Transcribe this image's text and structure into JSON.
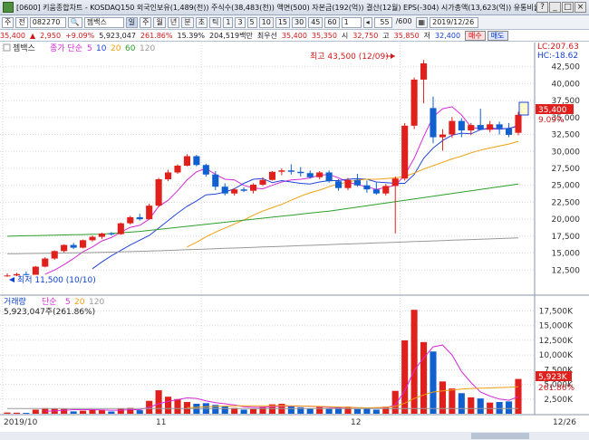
{
  "window": {
    "title": "[0600] 키움종합차트 - KOSDAQ150 외국인보유(1,489(천)) 주식수(38,483(천)) 액면(500) 자본금(192(억)) 결산(12월) EPS(-304) 시가총액(13,623(억)) 유통비율()",
    "buttons": [
      "?",
      "_",
      "□",
      "×"
    ]
  },
  "toolbar": {
    "market": "주",
    "period_type": "전",
    "code": "082270",
    "search_icon": "search-icon",
    "name": "젬백스",
    "intervals": [
      "일",
      "주",
      "월",
      "년",
      "분",
      "초",
      "틱"
    ],
    "tick_values": [
      "1",
      "3",
      "5",
      "10",
      "15",
      "30",
      "45",
      "60",
      "1"
    ],
    "count": "55",
    "total": "/600",
    "date": "2019/12/26"
  },
  "quote": {
    "price": "35,400",
    "change_dir": "▲",
    "change": "2,950",
    "change_pct": "+9.09%",
    "volume": "5,923,047",
    "vol_ratio": "261.86%",
    "turnover": "15.39%",
    "amount": "204,519백만",
    "limit_label": "최우선",
    "ask": "35,400",
    "bid": "35,350",
    "low_limit_label": "시",
    "open": "32,750",
    "high_label": "고",
    "high": "35,850",
    "low_label": "저",
    "low": "32,400",
    "buy_label": "매수",
    "sell_label": "매도"
  },
  "legend": {
    "price": {
      "name": "젬백스",
      "ma_label": "종가 단순",
      "periods": [
        "5",
        "10",
        "20",
        "60",
        "120"
      ]
    },
    "volume": {
      "name": "거래량",
      "ma_label": "단순",
      "periods": [
        "5",
        "20",
        "120"
      ],
      "info": "5,923,047주(261.86%)"
    }
  },
  "annotations": {
    "high": "최고 43,500 (12/09)",
    "low": "최저 11,500 (10/10)",
    "lc": "LC:207.63",
    "hc": "HC:-18.62",
    "last_price": "35,400",
    "last_pct": "9.09%",
    "last_volume": "5,923K",
    "last_vol_pct": "261.86%"
  },
  "chart_data": [
    {
      "type": "candlestick",
      "title": "젬백스",
      "ylim": [
        10000,
        45000
      ],
      "y_ticks": [
        12500,
        15000,
        17500,
        20000,
        22500,
        25000,
        27500,
        30000,
        32500,
        35000,
        37500,
        40000,
        42500
      ],
      "x_labels": [
        "2019/10",
        "11",
        "12",
        "12/26"
      ],
      "candles": [
        {
          "o": 11700,
          "h": 12000,
          "l": 11500,
          "c": 11700
        },
        {
          "o": 11700,
          "h": 12100,
          "l": 11600,
          "c": 11900
        },
        {
          "o": 11900,
          "h": 12300,
          "l": 11700,
          "c": 11800
        },
        {
          "o": 11800,
          "h": 13100,
          "l": 11800,
          "c": 13000
        },
        {
          "o": 13000,
          "h": 14400,
          "l": 12900,
          "c": 14200
        },
        {
          "o": 14200,
          "h": 15400,
          "l": 14000,
          "c": 15300
        },
        {
          "o": 15300,
          "h": 16300,
          "l": 15100,
          "c": 16200
        },
        {
          "o": 16200,
          "h": 16500,
          "l": 15600,
          "c": 15800
        },
        {
          "o": 15800,
          "h": 17000,
          "l": 15700,
          "c": 16900
        },
        {
          "o": 16900,
          "h": 17600,
          "l": 16700,
          "c": 17400
        },
        {
          "o": 17400,
          "h": 18000,
          "l": 17100,
          "c": 17900
        },
        {
          "o": 17900,
          "h": 18100,
          "l": 17600,
          "c": 17800
        },
        {
          "o": 17800,
          "h": 19500,
          "l": 17700,
          "c": 19400
        },
        {
          "o": 19400,
          "h": 20500,
          "l": 19200,
          "c": 20300
        },
        {
          "o": 20300,
          "h": 20800,
          "l": 19800,
          "c": 20000
        },
        {
          "o": 20000,
          "h": 22300,
          "l": 20000,
          "c": 22000
        },
        {
          "o": 22000,
          "h": 26100,
          "l": 21800,
          "c": 25900
        },
        {
          "o": 25900,
          "h": 27300,
          "l": 25600,
          "c": 26900
        },
        {
          "o": 26900,
          "h": 28100,
          "l": 26700,
          "c": 27900
        },
        {
          "o": 27900,
          "h": 29600,
          "l": 27800,
          "c": 29300
        },
        {
          "o": 29300,
          "h": 29500,
          "l": 27800,
          "c": 28000
        },
        {
          "o": 28000,
          "h": 28200,
          "l": 26300,
          "c": 26600
        },
        {
          "o": 26600,
          "h": 27100,
          "l": 24300,
          "c": 24800
        },
        {
          "o": 24800,
          "h": 25300,
          "l": 23500,
          "c": 23800
        },
        {
          "o": 23800,
          "h": 24600,
          "l": 23500,
          "c": 24400
        },
        {
          "o": 24400,
          "h": 24700,
          "l": 24000,
          "c": 24200
        },
        {
          "o": 24200,
          "h": 25300,
          "l": 23800,
          "c": 25100
        },
        {
          "o": 25100,
          "h": 26200,
          "l": 24900,
          "c": 25800
        },
        {
          "o": 25800,
          "h": 27100,
          "l": 25700,
          "c": 27000
        },
        {
          "o": 27000,
          "h": 27500,
          "l": 26500,
          "c": 27200
        },
        {
          "o": 27200,
          "h": 28100,
          "l": 26600,
          "c": 27000
        },
        {
          "o": 27000,
          "h": 27700,
          "l": 26300,
          "c": 26800
        },
        {
          "o": 26800,
          "h": 27200,
          "l": 26000,
          "c": 26200
        },
        {
          "o": 26200,
          "h": 27100,
          "l": 25900,
          "c": 26900
        },
        {
          "o": 26900,
          "h": 27200,
          "l": 25400,
          "c": 25600
        },
        {
          "o": 25600,
          "h": 25900,
          "l": 24200,
          "c": 24600
        },
        {
          "o": 24600,
          "h": 26100,
          "l": 24300,
          "c": 25800
        },
        {
          "o": 25800,
          "h": 26700,
          "l": 24800,
          "c": 25000
        },
        {
          "o": 25000,
          "h": 25700,
          "l": 23900,
          "c": 24400
        },
        {
          "o": 24400,
          "h": 25400,
          "l": 23600,
          "c": 23800
        },
        {
          "o": 23800,
          "h": 25200,
          "l": 23500,
          "c": 24900
        },
        {
          "o": 24900,
          "h": 26300,
          "l": 17900,
          "c": 26000
        },
        {
          "o": 26000,
          "h": 34200,
          "l": 25700,
          "c": 33800
        },
        {
          "o": 33800,
          "h": 40900,
          "l": 33300,
          "c": 40600
        },
        {
          "o": 40600,
          "h": 43500,
          "l": 37100,
          "c": 43000
        },
        {
          "o": 36400,
          "h": 38100,
          "l": 31200,
          "c": 32100
        },
        {
          "o": 32100,
          "h": 33300,
          "l": 30100,
          "c": 32500
        },
        {
          "o": 32500,
          "h": 35100,
          "l": 32000,
          "c": 34500
        },
        {
          "o": 34500,
          "h": 34900,
          "l": 32100,
          "c": 33100
        },
        {
          "o": 33100,
          "h": 34200,
          "l": 32400,
          "c": 33900
        },
        {
          "o": 33900,
          "h": 36300,
          "l": 33500,
          "c": 33200
        },
        {
          "o": 33200,
          "h": 34500,
          "l": 32800,
          "c": 34000
        },
        {
          "o": 34000,
          "h": 34400,
          "l": 32500,
          "c": 33400
        },
        {
          "o": 33400,
          "h": 34200,
          "l": 32100,
          "c": 32450
        },
        {
          "o": 32750,
          "h": 35850,
          "l": 32400,
          "c": 35400
        }
      ],
      "series": [
        {
          "name": "5",
          "color": "#d62ad6",
          "values": [
            null,
            null,
            null,
            null,
            11900,
            12500,
            13300,
            14200,
            15200,
            15900,
            16800,
            17300,
            18100,
            18800,
            19100,
            20000,
            21900,
            22800,
            24200,
            25800,
            27000,
            27500,
            26600,
            25900,
            25800,
            25000,
            24600,
            24500,
            25000,
            25500,
            25800,
            25900,
            26100,
            26500,
            26600,
            26100,
            25500,
            25100,
            24800,
            24400,
            24700,
            25000,
            26500,
            29000,
            32200,
            35100,
            36300,
            36600,
            35400,
            33600,
            33300,
            33300,
            33300,
            33400,
            33700
          ]
        },
        {
          "name": "10",
          "color": "#2244dd",
          "values": [
            null,
            null,
            null,
            null,
            null,
            null,
            null,
            null,
            null,
            12700,
            13700,
            14600,
            15400,
            16200,
            16900,
            17600,
            18700,
            19800,
            20900,
            21900,
            22700,
            23600,
            23700,
            24000,
            24500,
            25300,
            25900,
            26000,
            25400,
            25700,
            25500,
            25300,
            25200,
            25500,
            25700,
            25700,
            25900,
            26000,
            25900,
            25500,
            25400,
            25300,
            25300,
            26600,
            29000,
            30500,
            31600,
            32400,
            32700,
            32600,
            33200,
            33500,
            33300,
            33400,
            33800
          ]
        },
        {
          "name": "20",
          "color": "#f0a010",
          "values": [
            null,
            null,
            null,
            null,
            null,
            null,
            null,
            null,
            null,
            null,
            null,
            null,
            null,
            null,
            null,
            null,
            null,
            null,
            null,
            15900,
            16600,
            17400,
            18100,
            18700,
            19300,
            19900,
            20600,
            21200,
            21700,
            22200,
            22800,
            23400,
            23900,
            24300,
            24800,
            25200,
            25500,
            25800,
            25900,
            25900,
            26000,
            26100,
            26300,
            26800,
            27400,
            27900,
            28400,
            28900,
            29300,
            29800,
            30200,
            30500,
            30800,
            31100,
            31500
          ]
        },
        {
          "name": "60",
          "color": "#2ba02b",
          "values": [
            17500,
            17530,
            17560,
            17590,
            17620,
            17650,
            17680,
            17710,
            17740,
            17770,
            17800,
            17900,
            18000,
            18100,
            18200,
            18350,
            18500,
            18650,
            18800,
            18950,
            19100,
            19250,
            19400,
            19550,
            19700,
            19850,
            20000,
            20150,
            20300,
            20450,
            20600,
            20750,
            20900,
            21050,
            21200,
            21400,
            21600,
            21800,
            22000,
            22200,
            22400,
            22600,
            22800,
            23000,
            23200,
            23400,
            23600,
            23800,
            24000,
            24200,
            24400,
            24600,
            24800,
            25000,
            25200
          ]
        },
        {
          "name": "120",
          "color": "#999999",
          "values": [
            14900,
            14920,
            14940,
            14960,
            14980,
            15000,
            15020,
            15040,
            15060,
            15080,
            15100,
            15140,
            15180,
            15220,
            15260,
            15300,
            15350,
            15400,
            15450,
            15500,
            15550,
            15600,
            15650,
            15700,
            15750,
            15800,
            15850,
            15900,
            15950,
            16000,
            16050,
            16100,
            16150,
            16200,
            16250,
            16300,
            16350,
            16400,
            16450,
            16500,
            16550,
            16600,
            16650,
            16700,
            16750,
            16800,
            16850,
            16900,
            16950,
            17000,
            17050,
            17100,
            17150,
            17200,
            17250
          ]
        }
      ]
    },
    {
      "type": "bar",
      "title": "거래량",
      "ylim": [
        0,
        18500000
      ],
      "y_ticks": [
        "2,500K",
        "5,000K",
        "7,500K",
        "10,000K",
        "12,500K",
        "15,000K",
        "17,500K"
      ],
      "values": [
        210000,
        180000,
        150000,
        700000,
        950000,
        900000,
        820000,
        400000,
        520000,
        700000,
        600000,
        380000,
        900000,
        1000000,
        600000,
        2200000,
        4000000,
        2900000,
        2500000,
        2000000,
        1700000,
        1800000,
        1500000,
        1300000,
        1000000,
        700000,
        800000,
        1200000,
        1600000,
        1700000,
        1300000,
        1100000,
        900000,
        1200000,
        900000,
        1100000,
        1200000,
        800000,
        1000000,
        700000,
        1200000,
        3900000,
        12500000,
        17700000,
        12200000,
        10600000,
        5500000,
        4300000,
        3500000,
        2800000,
        2600000,
        1900000,
        2000000,
        2100000,
        5923047
      ],
      "up": [
        1,
        1,
        0,
        1,
        1,
        1,
        1,
        0,
        1,
        1,
        1,
        0,
        1,
        1,
        0,
        1,
        1,
        1,
        1,
        1,
        0,
        0,
        0,
        0,
        1,
        0,
        1,
        1,
        1,
        1,
        0,
        0,
        0,
        1,
        0,
        0,
        1,
        0,
        0,
        0,
        1,
        1,
        1,
        1,
        1,
        0,
        1,
        1,
        0,
        1,
        0,
        1,
        0,
        0,
        1
      ],
      "series": [
        {
          "name": "5",
          "color": "#d62ad6",
          "values": [
            null,
            null,
            null,
            null,
            400000,
            500000,
            600000,
            700000,
            700000,
            700000,
            650000,
            600000,
            600000,
            700000,
            700000,
            1100000,
            1700000,
            2100000,
            2400000,
            2700000,
            2600000,
            2200000,
            1900000,
            1700000,
            1500000,
            1200000,
            1100000,
            1100000,
            1200000,
            1300000,
            1300000,
            1300000,
            1300000,
            1200000,
            1100000,
            1000000,
            1100000,
            1000000,
            1000000,
            1000000,
            1000000,
            1500000,
            3900000,
            7400000,
            9500000,
            11400000,
            11700000,
            10000000,
            7200000,
            5300000,
            3700000,
            3000000,
            2500000,
            2300000,
            2900000
          ]
        },
        {
          "name": "20",
          "color": "#f0a010",
          "values": [
            null,
            null,
            null,
            null,
            null,
            null,
            null,
            null,
            null,
            null,
            null,
            null,
            null,
            null,
            null,
            null,
            null,
            null,
            null,
            1050000,
            1100000,
            1180000,
            1250000,
            1300000,
            1350000,
            1350000,
            1350000,
            1350000,
            1360000,
            1380000,
            1350000,
            1320000,
            1280000,
            1250000,
            1200000,
            1150000,
            1100000,
            1050000,
            1000000,
            1050000,
            1100000,
            1250000,
            1800000,
            2600000,
            3200000,
            3700000,
            3900000,
            4050000,
            4200000,
            4300000,
            4350000,
            4400000,
            4450000,
            4500000,
            4600000
          ]
        },
        {
          "name": "120",
          "color": "#999999",
          "values": [
            900000,
            900000,
            900000,
            900000,
            900000,
            900000,
            900000,
            900000,
            900000,
            900000,
            900000,
            900000,
            900000,
            900000,
            900000,
            900000,
            900000,
            900000,
            900000,
            900000,
            900000,
            900000,
            900000,
            900000,
            900000,
            900000,
            900000,
            900000,
            900000,
            900000,
            900000,
            900000,
            900000,
            900000,
            900000,
            900000,
            900000,
            900000,
            900000,
            900000,
            900000,
            900000,
            900000,
            900000,
            900000,
            900000,
            900000,
            900000,
            900000,
            900000,
            900000,
            900000,
            900000,
            900000,
            900000
          ]
        }
      ]
    }
  ],
  "colors": {
    "up": "#e0201c",
    "down": "#1060d0",
    "grid": "#d8d8d8",
    "label_bg": "#e0201c"
  }
}
